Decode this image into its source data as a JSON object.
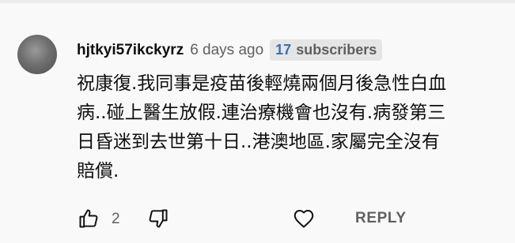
{
  "comment": {
    "author": "hjtkyi57ikckyrz",
    "time": "6 days ago",
    "subscriber_count": "17",
    "subscriber_label": "subscribers",
    "lines": [
      "祝康復.我同事是疫苗後輕燒兩個月後急性白血",
      "病..碰上醫生放假.連治療機會也沒有.病發第三",
      "日昏迷到去世第十日..港澳地區.家屬完全沒有",
      "賠償."
    ],
    "like_count": "2",
    "reply_label": "REPLY"
  },
  "icons": {
    "avatar": "avatar",
    "like": "thumbs-up-icon",
    "dislike": "thumbs-down-icon",
    "heart": "heart-icon"
  },
  "colors": {
    "background": "#f9f9f9",
    "subscriber_count": "#3a6fb5",
    "secondary_text": "#606060"
  }
}
